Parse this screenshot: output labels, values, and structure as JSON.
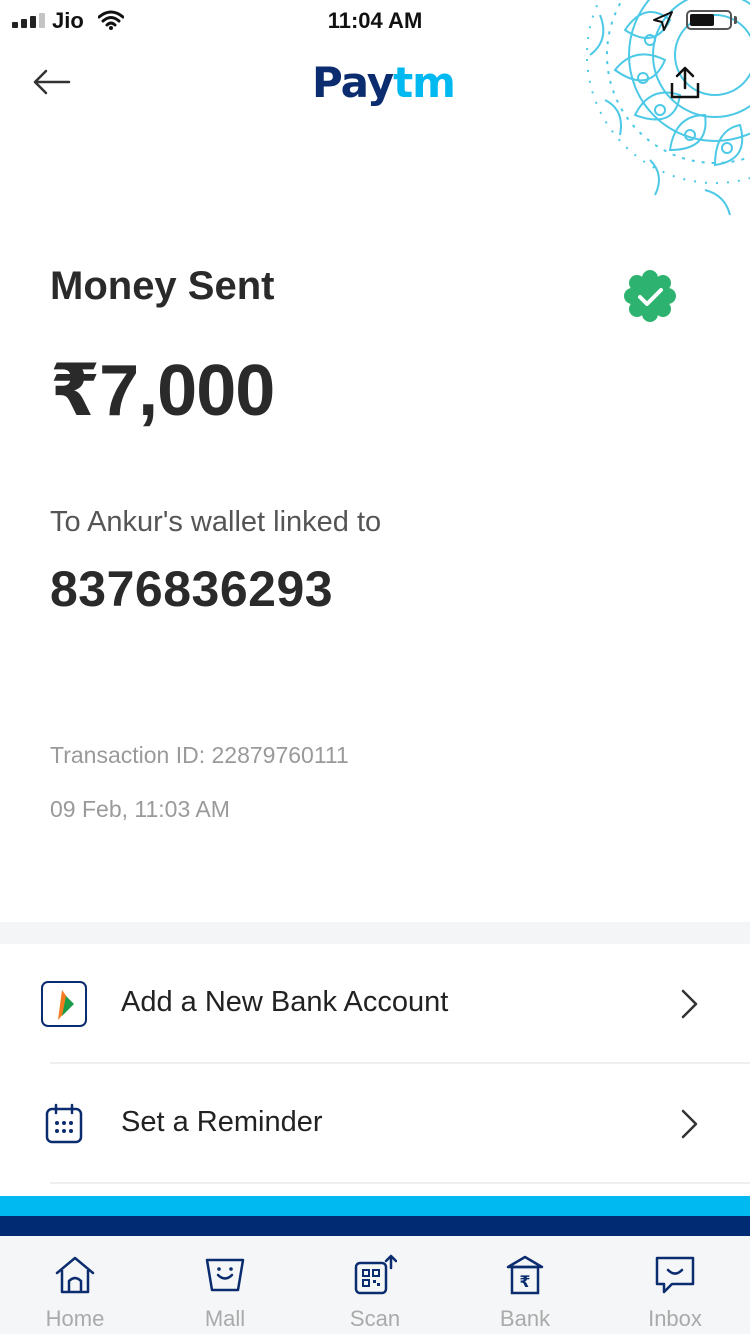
{
  "status_bar": {
    "carrier": "Jio",
    "time": "11:04 AM",
    "signal_bars": 3,
    "signal_bars_total": 4,
    "battery_level": 0.6
  },
  "header": {
    "logo_left": "Pay",
    "logo_right": "tm",
    "back_icon": "arrow-left-icon",
    "share_icon": "share-icon"
  },
  "transaction": {
    "title": "Money Sent",
    "amount": "₹7,000",
    "recipient_label": "To Ankur's wallet linked to",
    "recipient_number": "8376836293",
    "transaction_id": "Transaction ID: 22879760111",
    "datetime": "09 Feb, 11:03 AM",
    "status_icon": "check-badge-icon"
  },
  "actions": [
    {
      "label": "Add a New Bank Account",
      "icon": "bhim-upi-icon"
    },
    {
      "label": "Set a Reminder",
      "icon": "calendar-icon"
    }
  ],
  "bottom_nav": [
    {
      "label": "Home",
      "icon": "home-icon"
    },
    {
      "label": "Mall",
      "icon": "shopping-bag-icon"
    },
    {
      "label": "Scan",
      "icon": "qr-scan-icon"
    },
    {
      "label": "Bank",
      "icon": "bank-icon"
    },
    {
      "label": "Inbox",
      "icon": "chat-icon"
    }
  ],
  "colors": {
    "brand_dark": "#0b2c6e",
    "brand_light": "#00b9f1",
    "success": "#2db36f",
    "stripe_dark": "#012b72",
    "mandala": "#4cc9e6"
  }
}
